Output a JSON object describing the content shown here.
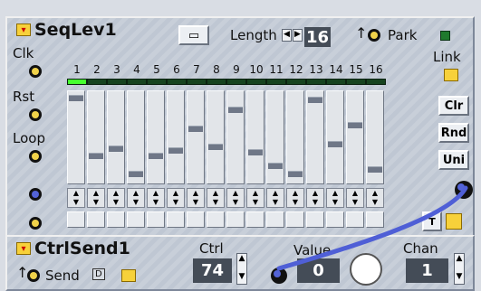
{
  "sequencer": {
    "title": "SeqLev1",
    "length_label": "Length",
    "length_value": "16",
    "park_label": "Park",
    "link_label": "Link",
    "left_labels": {
      "clk": "Clk",
      "rst": "Rst",
      "loop": "Loop"
    },
    "buttons": {
      "clr": "Clr",
      "rnd": "Rnd",
      "uni": "Uni"
    },
    "steps": [
      {
        "num": "1",
        "value": 0.98,
        "active": true
      },
      {
        "num": "2",
        "value": 0.3,
        "active": false
      },
      {
        "num": "3",
        "value": 0.38,
        "active": false
      },
      {
        "num": "4",
        "value": 0.08,
        "active": false
      },
      {
        "num": "5",
        "value": 0.3,
        "active": false
      },
      {
        "num": "6",
        "value": 0.36,
        "active": false
      },
      {
        "num": "7",
        "value": 0.62,
        "active": false
      },
      {
        "num": "8",
        "value": 0.4,
        "active": false
      },
      {
        "num": "9",
        "value": 0.84,
        "active": false
      },
      {
        "num": "10",
        "value": 0.34,
        "active": false
      },
      {
        "num": "11",
        "value": 0.18,
        "active": false
      },
      {
        "num": "12",
        "value": 0.08,
        "active": false
      },
      {
        "num": "13",
        "value": 0.96,
        "active": false
      },
      {
        "num": "14",
        "value": 0.44,
        "active": false
      },
      {
        "num": "15",
        "value": 0.66,
        "active": false
      },
      {
        "num": "16",
        "value": 0.14,
        "active": false
      }
    ],
    "gate_label": "T"
  },
  "ctrlsend": {
    "title": "CtrlSend1",
    "send_label": "Send",
    "send_mid": "D",
    "ctrl_label": "Ctrl",
    "ctrl_value": "74",
    "value_label": "Value",
    "value_value": "0",
    "chan_label": "Chan",
    "chan_value": "1"
  },
  "colors": {
    "panel": "#c8cfd9",
    "led_on": "#46ff2f",
    "led_off": "#16431f",
    "cable": "#4f5fd6",
    "jack_yellow": "#f0d24a"
  }
}
